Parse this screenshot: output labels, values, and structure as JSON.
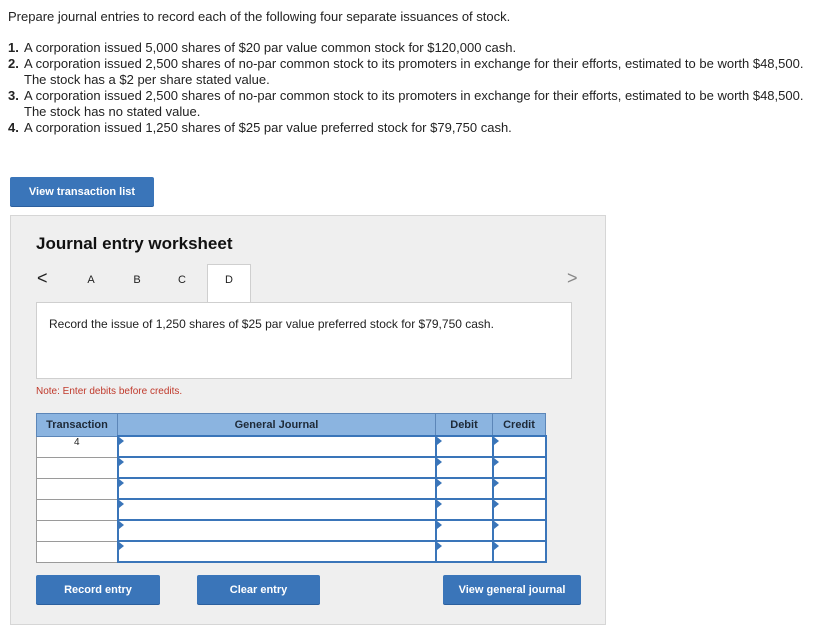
{
  "instructions": "Prepare journal entries to record each of the following four separate issuances of stock.",
  "questions": [
    {
      "num": "1.",
      "text": "A corporation issued 5,000 shares of $20 par value common stock for $120,000 cash."
    },
    {
      "num": "2.",
      "text": "A corporation issued 2,500 shares of no-par common stock to its promoters in exchange for their efforts, estimated to be worth $48,500. The stock has a $2 per share stated value."
    },
    {
      "num": "3.",
      "text": "A corporation issued 2,500 shares of no-par common stock to its promoters in exchange for their efforts, estimated to be worth $48,500. The stock has no stated value."
    },
    {
      "num": "4.",
      "text": "A corporation issued 1,250 shares of $25 par value preferred stock for $79,750 cash."
    }
  ],
  "buttons": {
    "view_transactions": "View transaction list",
    "record": "Record entry",
    "clear": "Clear entry",
    "view_journal": "View general journal"
  },
  "worksheet": {
    "title": "Journal entry worksheet",
    "tabs": [
      "A",
      "B",
      "C",
      "D"
    ],
    "active_tab": "D",
    "arrow_left": "<",
    "arrow_right": ">",
    "description": "Record the issue of 1,250 shares of $25 par value preferred stock for $79,750 cash.",
    "note": "Note: Enter debits before credits."
  },
  "table": {
    "headers": {
      "transaction": "Transaction",
      "journal": "General Journal",
      "debit": "Debit",
      "credit": "Credit"
    },
    "rows": [
      {
        "transaction": "4",
        "account": "",
        "debit": "",
        "credit": ""
      },
      {
        "transaction": "",
        "account": "",
        "debit": "",
        "credit": ""
      },
      {
        "transaction": "",
        "account": "",
        "debit": "",
        "credit": ""
      },
      {
        "transaction": "",
        "account": "",
        "debit": "",
        "credit": ""
      },
      {
        "transaction": "",
        "account": "",
        "debit": "",
        "credit": ""
      },
      {
        "transaction": "",
        "account": "",
        "debit": "",
        "credit": ""
      }
    ]
  },
  "colors": {
    "button": "#3a75b9",
    "header": "#8bb4e0",
    "note": "#c0392b"
  }
}
